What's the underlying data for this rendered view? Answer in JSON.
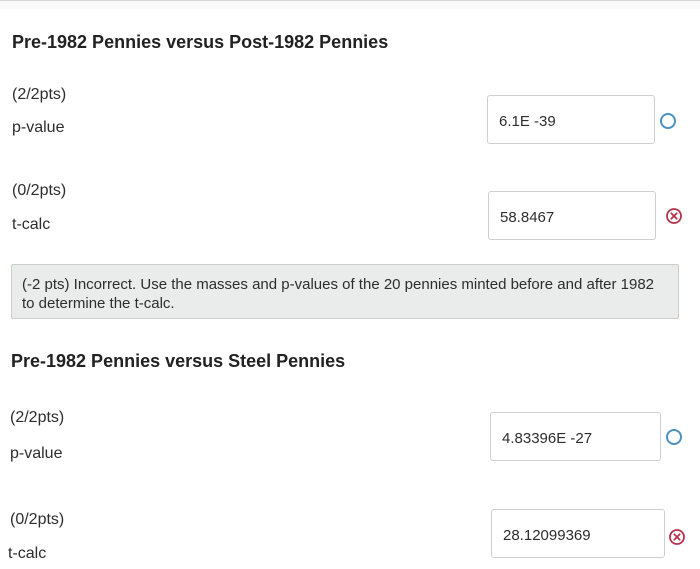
{
  "sections": [
    {
      "title": "Pre-1982 Pennies versus Post-1982 Pennies",
      "questions": [
        {
          "points": "(2/2pts)",
          "label": "p-value",
          "answer": "6.1E -39",
          "status": "correct"
        },
        {
          "points": "(0/2pts)",
          "label": "t-calc",
          "answer": "58.8467",
          "status": "incorrect"
        }
      ],
      "feedback": "(-2 pts) Incorrect. Use the masses and p-values of the 20 pennies minted before and after 1982 to determine the t-calc."
    },
    {
      "title": "Pre-1982 Pennies versus Steel Pennies",
      "questions": [
        {
          "points": "(2/2pts)",
          "label": "p-value",
          "answer": "4.83396E -27",
          "status": "correct"
        },
        {
          "points": "(0/2pts)",
          "label": "t-calc",
          "answer": "28.12099369",
          "status": "incorrect"
        }
      ]
    }
  ],
  "colors": {
    "correct": "#4d90c4",
    "incorrect": "#b8324a"
  },
  "icons": {
    "correct": "circle-icon",
    "incorrect": "x-circle-icon"
  }
}
